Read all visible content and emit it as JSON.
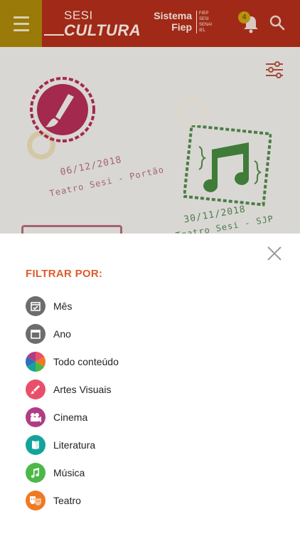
{
  "header": {
    "logo_top": "SESI",
    "logo_main": "CULTURA",
    "system_name_line1": "Sistema",
    "system_name_line2": "Fiep",
    "system_tags": [
      "FIEP",
      "SESI",
      "SENAI",
      "IEL"
    ],
    "notification_count": "4",
    "icons": {
      "menu": "hamburger-menu-icon",
      "bell": "bell-icon",
      "search": "search-icon"
    }
  },
  "background": {
    "cards": [
      {
        "date": "06/12/2018",
        "venue": "Teatro Sesi - Portão"
      },
      {
        "date": "30/11/2018",
        "venue": "Teatro Sesi - SJP"
      }
    ],
    "filter_icon": "sliders-icon"
  },
  "filter": {
    "title": "FILTRAR POR:",
    "close_icon": "close-icon",
    "options": [
      {
        "label": "Mês",
        "icon": "calendar-check-icon",
        "color": "#6d6d6d"
      },
      {
        "label": "Ano",
        "icon": "calendar-icon",
        "color": "#6d6d6d"
      },
      {
        "label": "Todo conteúdo",
        "icon": "pie-icon",
        "color": "multi"
      },
      {
        "label": "Artes Visuais",
        "icon": "brush-icon",
        "color": "#e94f6a"
      },
      {
        "label": "Cinema",
        "icon": "film-camera-icon",
        "color": "#b03c87"
      },
      {
        "label": "Literatura",
        "icon": "book-icon",
        "color": "#14a39a"
      },
      {
        "label": "Música",
        "icon": "music-note-icon",
        "color": "#4bb848"
      },
      {
        "label": "Teatro",
        "icon": "theater-masks-icon",
        "color": "#ee7a23"
      }
    ]
  },
  "colors": {
    "header": "#a02a17",
    "menu": "#9a7a08",
    "accent": "#e25a2c"
  }
}
